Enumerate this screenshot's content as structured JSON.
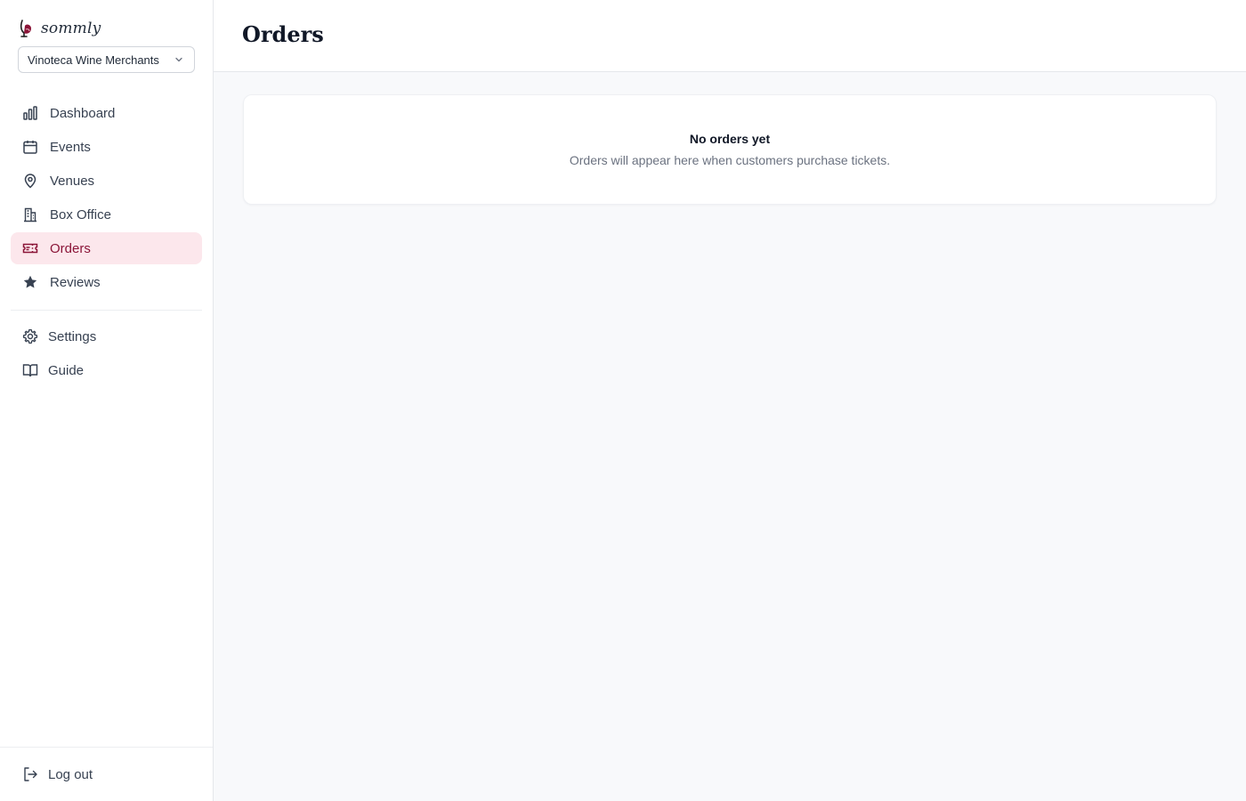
{
  "brand": {
    "name": "sommly",
    "logo_icon": "wine-glass-logo-icon",
    "accent": "#8b1538"
  },
  "org_selector": {
    "value": "Vinoteca Wine Merchants",
    "icon": "chevron-down-icon"
  },
  "sidebar": {
    "items": [
      {
        "label": "Dashboard",
        "icon": "bar-chart-icon",
        "active": false
      },
      {
        "label": "Events",
        "icon": "calendar-icon",
        "active": false
      },
      {
        "label": "Venues",
        "icon": "map-pin-icon",
        "active": false
      },
      {
        "label": "Box Office",
        "icon": "building-icon",
        "active": false
      },
      {
        "label": "Orders",
        "icon": "ticket-icon",
        "active": true
      },
      {
        "label": "Reviews",
        "icon": "star-icon",
        "active": false
      }
    ],
    "secondary": [
      {
        "label": "Settings",
        "icon": "gear-icon"
      },
      {
        "label": "Guide",
        "icon": "book-icon"
      }
    ],
    "logout": {
      "label": "Log out",
      "icon": "logout-icon"
    }
  },
  "header": {
    "title": "Orders"
  },
  "empty_state": {
    "title": "No orders yet",
    "description": "Orders will appear here when customers purchase tickets."
  },
  "colors": {
    "active_bg": "#fce7ec",
    "active_text": "#8b1538",
    "page_bg": "#f8f9fb",
    "border": "#e5e7eb"
  }
}
